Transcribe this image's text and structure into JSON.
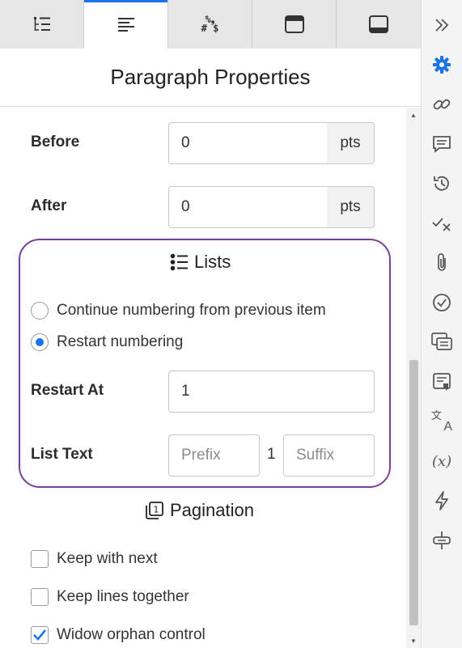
{
  "tabs": [
    {
      "name": "list-tree-tab",
      "icon": "list-tree-icon"
    },
    {
      "name": "paragraph-tab",
      "icon": "paragraph-align-icon",
      "active": true
    },
    {
      "name": "symbols-tab",
      "icon": "symbols-icon",
      "glyph_top": "%❟",
      "glyph_bottom": "# $"
    },
    {
      "name": "header-tab",
      "icon": "header-layout-icon"
    },
    {
      "name": "footer-tab",
      "icon": "footer-layout-icon"
    }
  ],
  "panel": {
    "title": "Paragraph Properties",
    "before": {
      "label": "Before",
      "value": "0",
      "unit": "pts"
    },
    "after": {
      "label": "After",
      "value": "0",
      "unit": "pts"
    },
    "lists": {
      "heading": "Lists",
      "continue_label": "Continue numbering from previous item",
      "restart_label": "Restart numbering",
      "restart_selected": true,
      "restart_at_label": "Restart At",
      "restart_at_value": "1",
      "list_text_label": "List Text",
      "prefix_placeholder": "Prefix",
      "number": "1",
      "suffix_placeholder": "Suffix"
    },
    "pagination": {
      "heading": "Pagination",
      "keep_with_next": "Keep with next",
      "keep_lines_together": "Keep lines together",
      "widow_orphan": "Widow orphan control",
      "keep_with_next_checked": false,
      "keep_lines_together_checked": false,
      "widow_orphan_checked": true
    }
  },
  "sidebar": {
    "icons": [
      "double-chevron-right-icon",
      "gear-icon",
      "link-icon",
      "comment-icon",
      "history-icon",
      "track-changes-icon",
      "paperclip-icon",
      "check-circle-icon",
      "comments-list-icon",
      "note-icon",
      "translate-icon",
      "variable-icon",
      "lightning-icon",
      "merge-icon"
    ],
    "variable_glyph": "(x)",
    "translate_glyph_top": "文",
    "translate_glyph_bottom": "A"
  },
  "colors": {
    "accent": "#1a73e8",
    "group_border": "#7b3f9b",
    "sidebar_active": "#1a73e8"
  }
}
